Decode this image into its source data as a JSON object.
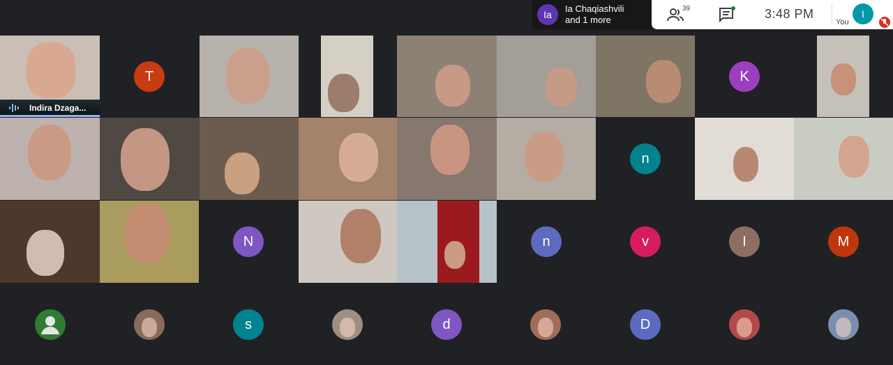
{
  "presenting": {
    "initials": "Ia",
    "line1": "Ia Chaqiashvili",
    "line2": "and 1 more"
  },
  "topbar": {
    "people_icon": "people-icon",
    "people_count": "39",
    "chat_icon": "chat-icon",
    "time": "3:48  PM",
    "self_initial": "I",
    "self_label": "You",
    "mic_icon": "mic-off-icon"
  },
  "speaker": {
    "name": "Indira Dzaga..."
  },
  "letter_tiles": [
    {
      "letter": "T",
      "color": "#c93b10"
    },
    {
      "letter": "K",
      "color": "#9c3fbe"
    },
    {
      "letter": "n",
      "color": "#00838f"
    },
    {
      "letter": "N",
      "color": "#7e57c2"
    },
    {
      "letter": "n",
      "color": "#5c6bc0"
    },
    {
      "letter": "v",
      "color": "#d81b60"
    },
    {
      "letter": "I",
      "color": "#8d6e63"
    },
    {
      "letter": "M",
      "color": "#bf360c"
    }
  ],
  "bottom_row": [
    {
      "kind": "avatar",
      "icon": "default-avatar-icon",
      "color": "#2e7d32"
    },
    {
      "kind": "photo",
      "color": "#8a6a5a"
    },
    {
      "kind": "letter",
      "letter": "s",
      "color": "#00838f"
    },
    {
      "kind": "photo",
      "color": "#9e8f80"
    },
    {
      "kind": "letter",
      "letter": "d",
      "color": "#7e57c2"
    },
    {
      "kind": "photo",
      "color": "#a06d5a"
    },
    {
      "kind": "letter",
      "letter": "D",
      "color": "#5c6bc0"
    },
    {
      "kind": "photo",
      "color": "#b24a4a"
    },
    {
      "kind": "photo",
      "color": "#7a8fb0"
    }
  ]
}
